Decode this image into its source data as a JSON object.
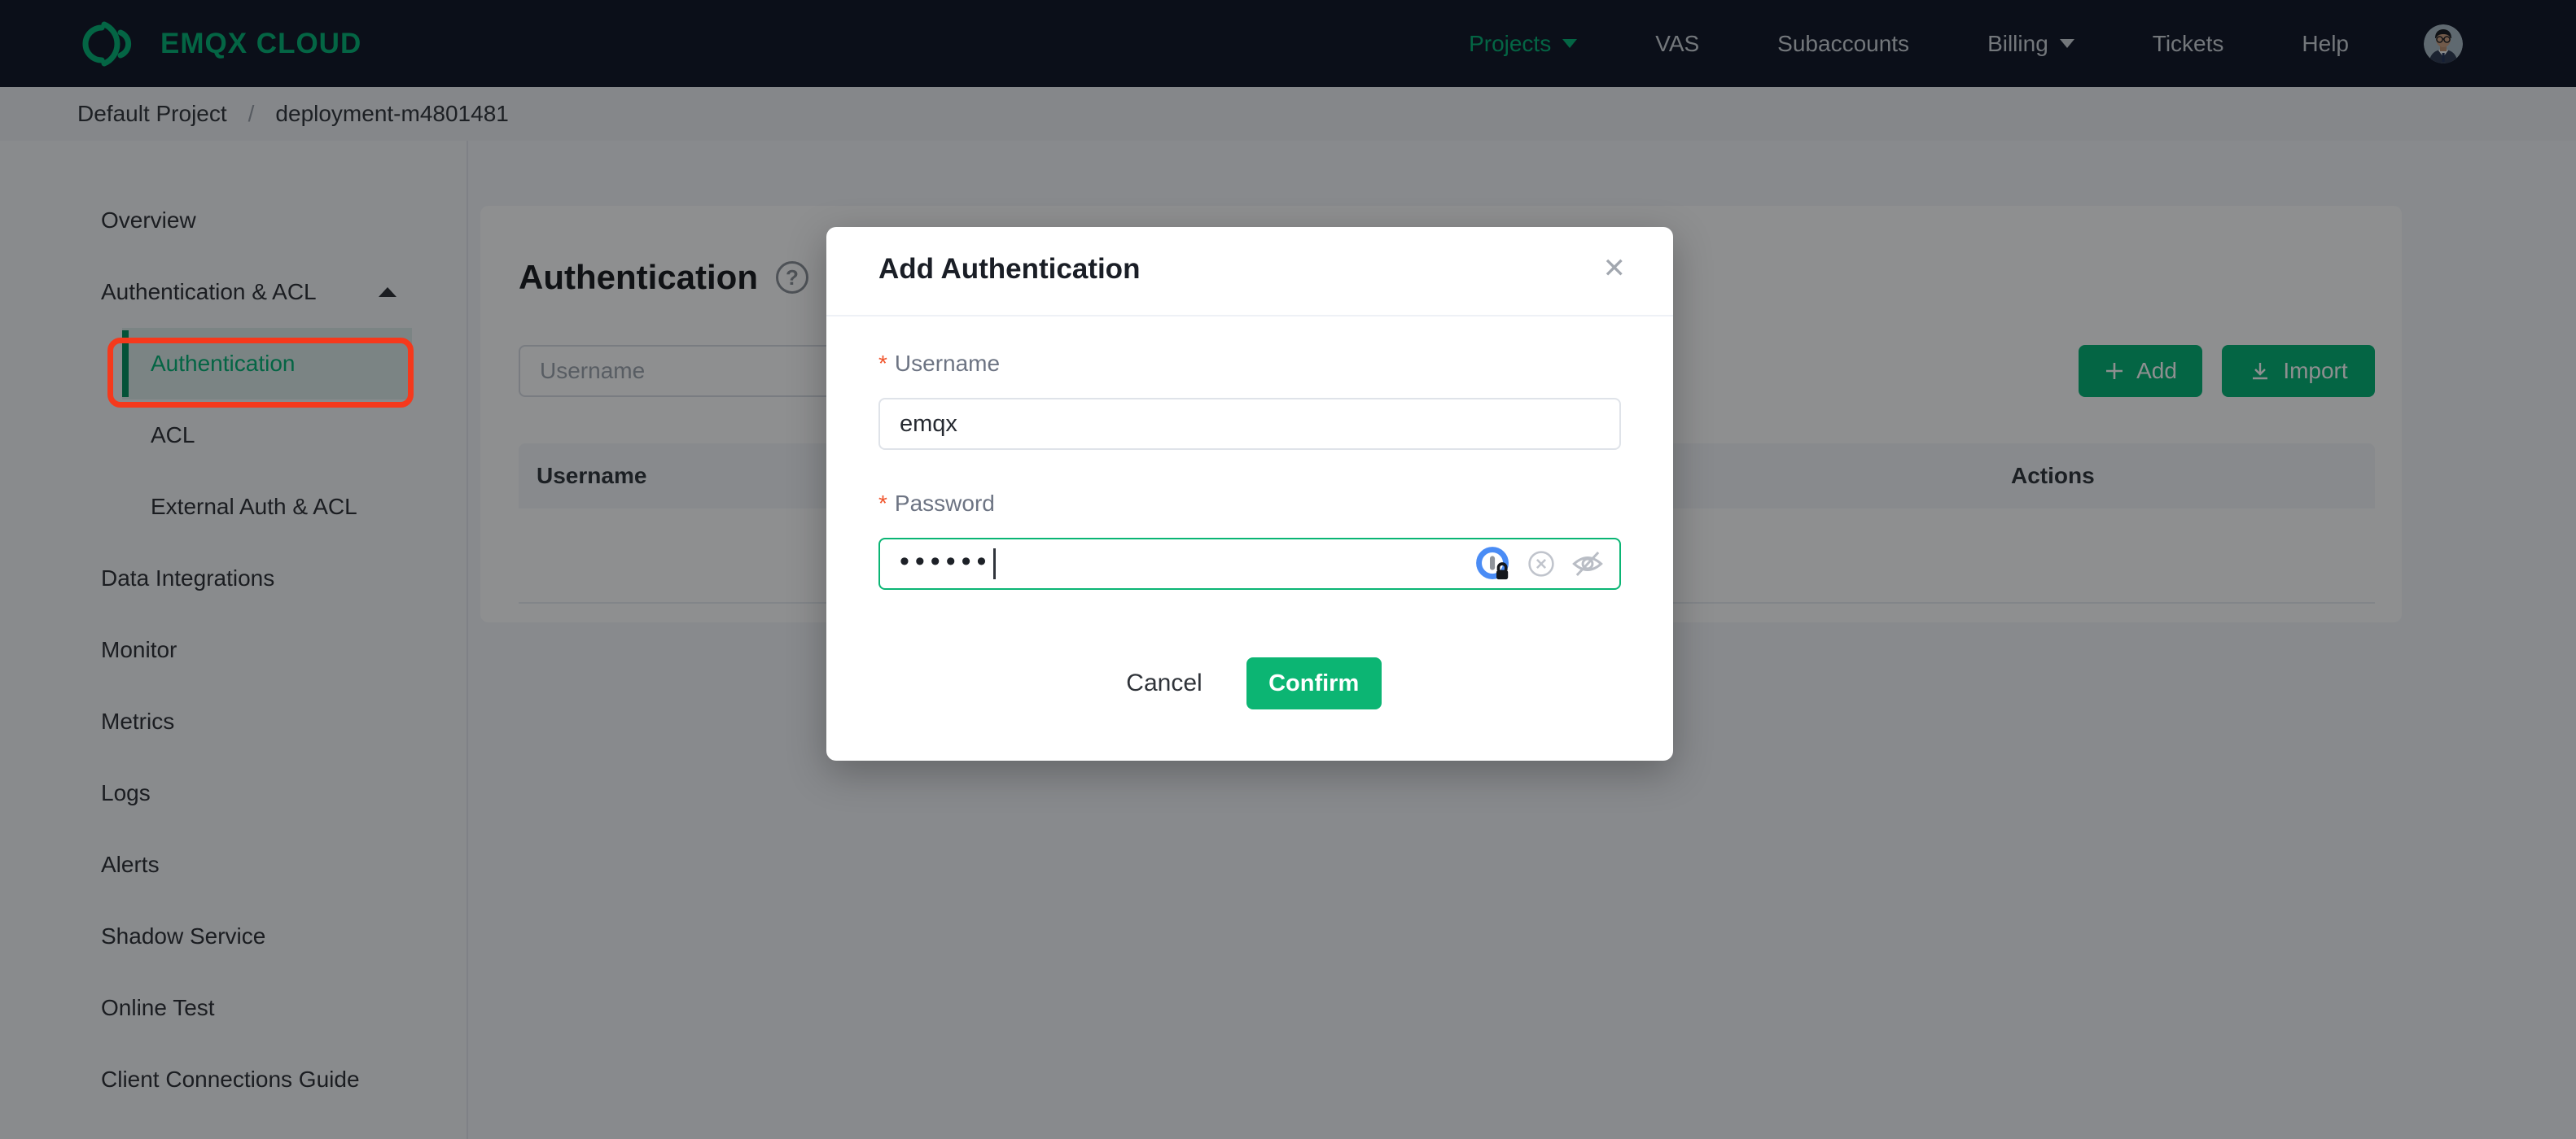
{
  "navbar": {
    "logo_text": "EMQX CLOUD",
    "items": [
      {
        "label": "Projects",
        "caret": true,
        "active": true
      },
      {
        "label": "VAS"
      },
      {
        "label": "Subaccounts"
      },
      {
        "label": "Billing",
        "caret": true
      },
      {
        "label": "Tickets"
      },
      {
        "label": "Help"
      }
    ]
  },
  "breadcrumb": {
    "project": "Default Project",
    "separator": "/",
    "deployment": "deployment-m4801481"
  },
  "sidebar": {
    "items": [
      {
        "label": "Overview",
        "level": "top"
      },
      {
        "label": "Authentication & ACL",
        "level": "group",
        "expanded": true
      },
      {
        "label": "Authentication",
        "level": "sub",
        "active": true,
        "annotated": true
      },
      {
        "label": "ACL",
        "level": "sub"
      },
      {
        "label": "External Auth & ACL",
        "level": "sub"
      },
      {
        "label": "Data Integrations",
        "level": "top"
      },
      {
        "label": "Monitor",
        "level": "top"
      },
      {
        "label": "Metrics",
        "level": "top"
      },
      {
        "label": "Logs",
        "level": "top"
      },
      {
        "label": "Alerts",
        "level": "top"
      },
      {
        "label": "Shadow Service",
        "level": "top"
      },
      {
        "label": "Online Test",
        "level": "top"
      },
      {
        "label": "Client Connections Guide",
        "level": "top"
      }
    ]
  },
  "main": {
    "title": "Authentication",
    "help_icon": "question-circle",
    "search_placeholder": "Username",
    "add_label": "Add",
    "import_label": "Import",
    "table": {
      "columns": [
        "Username",
        "Actions"
      ]
    }
  },
  "modal": {
    "title": "Add Authentication",
    "close_glyph": "✕",
    "required_marker": "*",
    "username_label": "Username",
    "username_value": "emqx",
    "password_label": "Password",
    "password_masked": "••••••",
    "cancel_label": "Cancel",
    "confirm_label": "Confirm"
  },
  "colors": {
    "brand_green": "#00b173",
    "confirm_green": "#0cb573",
    "navbar_bg": "#0d1424",
    "annotation_red": "#f5391c",
    "required_red": "#f0542c"
  }
}
